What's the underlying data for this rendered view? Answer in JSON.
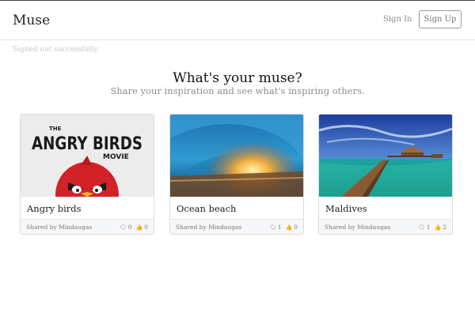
{
  "nav": {
    "brand": "Muse",
    "signin": "Sign In",
    "signup": "Sign Up"
  },
  "flash": "Signed out successfully.",
  "hero": {
    "title": "What's your muse?",
    "subtitle": "Share your inspiration and see what's inspiring others."
  },
  "icons": {
    "comment": "comment-icon",
    "like": "thumbs-up-icon"
  },
  "cards": [
    {
      "title": "Angry birds",
      "shared": "Shared by Mindaugas",
      "comments": "0",
      "likes": "0",
      "image_text": [
        "THE",
        "ANGRY BIRDS",
        "MOVIE"
      ]
    },
    {
      "title": "Ocean beach",
      "shared": "Shared by Mindaugas",
      "comments": "1",
      "likes": "0"
    },
    {
      "title": "Maldives",
      "shared": "Shared by Mindaugas",
      "comments": "1",
      "likes": "2"
    }
  ]
}
